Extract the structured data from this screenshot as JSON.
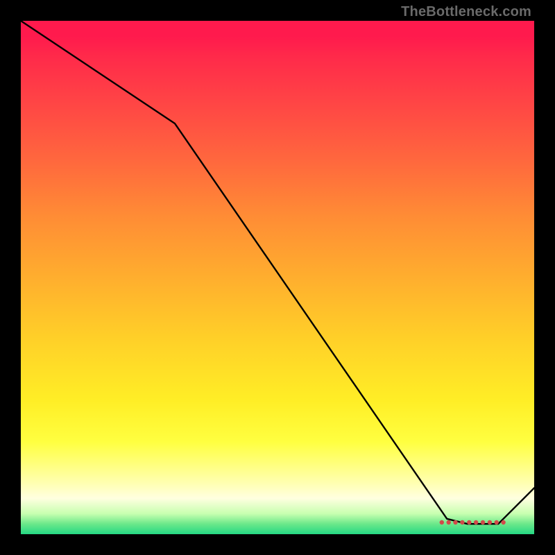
{
  "watermark": "TheBottleneck.com",
  "chart_data": {
    "type": "line",
    "title": "",
    "xlabel": "",
    "ylabel": "",
    "xlim": [
      0,
      100
    ],
    "ylim": [
      0,
      100
    ],
    "x": [
      0,
      30,
      83,
      87,
      93,
      100
    ],
    "values": [
      100,
      80,
      3,
      2,
      2,
      9
    ],
    "annotations": [],
    "background": "vertical heat gradient red→yellow→green",
    "marker_cluster": {
      "y": 2.3,
      "x_start": 82,
      "x_end": 94,
      "count_approx": 10,
      "color": "#d24a4a"
    }
  },
  "colors": {
    "frame": "#000000",
    "line": "#000000",
    "marker": "#d24a4a",
    "watermark": "#6a6a6a"
  }
}
